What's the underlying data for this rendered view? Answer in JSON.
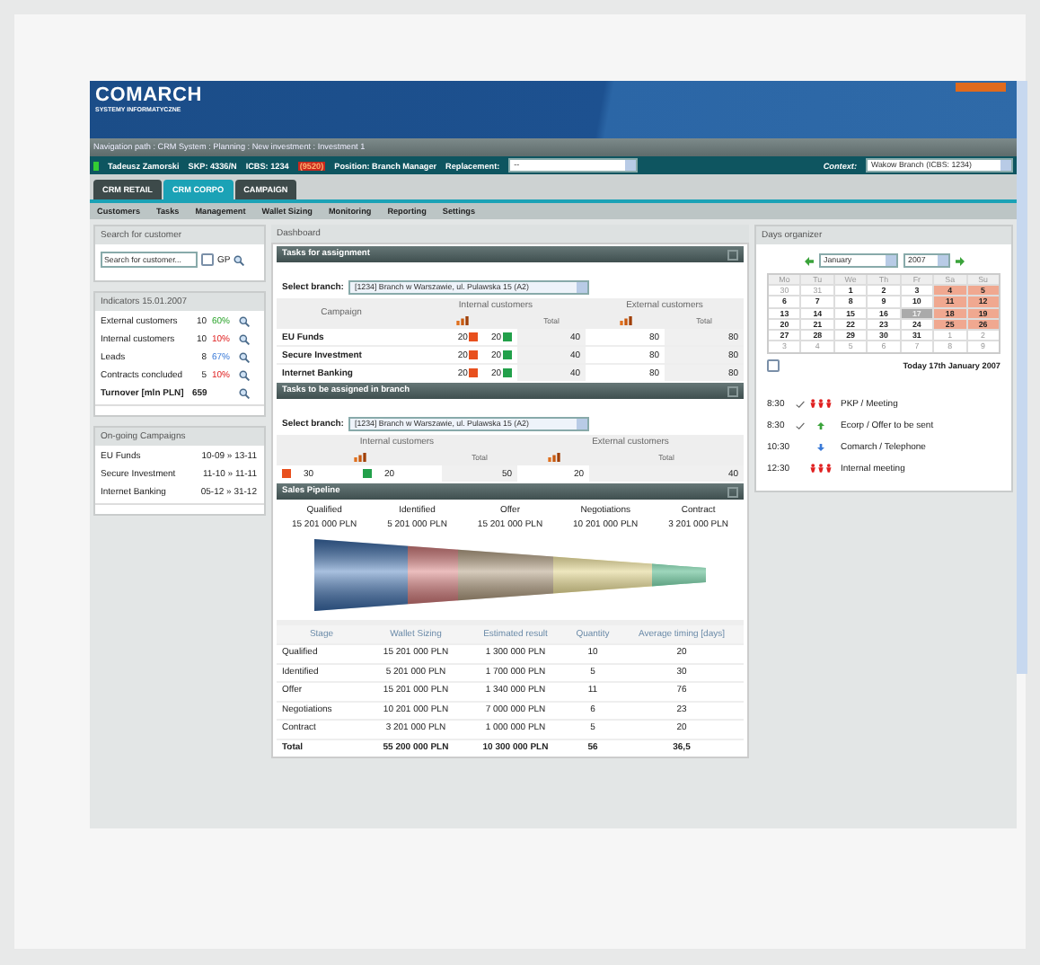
{
  "header": {
    "logo": "COMARCH",
    "tagline": "SYSTEMY INFORMATYCZNE"
  },
  "nav_path": "Navigation path : CRM System : Planning : New investment : Investment 1",
  "user_bar": {
    "user": "Tadeusz Zamorski",
    "skp": "SKP: 4336/N",
    "icbs": "ICBS: 1234",
    "icbs_code": "(9520)",
    "position": "Position: Branch Manager",
    "replacement_label": "Replacement:",
    "replacement_value": "--",
    "context_label": "Context:",
    "context_value": "Wakow Branch (ICBS: 1234)"
  },
  "tabs": [
    {
      "label": "CRM RETAIL",
      "selected": false
    },
    {
      "label": "CRM CORPO",
      "selected": true
    },
    {
      "label": "CAMPAIGN",
      "selected": false
    }
  ],
  "menu": [
    "Customers",
    "Tasks",
    "Management",
    "Wallet Sizing",
    "Monitoring",
    "Reporting",
    "Settings"
  ],
  "search": {
    "title": "Search for customer",
    "placeholder": "Search for customer...",
    "checkbox_label": "GP",
    "checked": false
  },
  "indicators": {
    "title": "Indicators 15.01.2007",
    "rows": [
      {
        "label": "External customers",
        "value": "10",
        "percent": "60%",
        "kind": "good",
        "bold": false
      },
      {
        "label": "Internal customers",
        "value": "10",
        "percent": "10%",
        "kind": "bad",
        "bold": false
      },
      {
        "label": "Leads",
        "value": "8",
        "percent": "67%",
        "kind": "info",
        "bold": false
      },
      {
        "label": "Contracts concluded",
        "value": "5",
        "percent": "10%",
        "kind": "bad",
        "bold": false
      },
      {
        "label": "Turnover [mln PLN]",
        "value": "659",
        "bold": true
      }
    ]
  },
  "campaigns": {
    "title": "On-going Campaigns",
    "rows": [
      {
        "name": "EU Funds",
        "dates": "10-09 » 13-11"
      },
      {
        "name": "Secure Investment",
        "dates": "11-10 » 11-11"
      },
      {
        "name": "Internet Banking",
        "dates": "05-12 » 31-12"
      }
    ]
  },
  "dashboard": {
    "title": "Dashboard",
    "tasks_for_assignment": {
      "title": "Tasks for assignment",
      "branch_label": "Select branch:",
      "branch_value": "[1234] Branch w Warszawie, ul. Pulawska 15 (A2)",
      "col_campaign": "Campaign",
      "col_internal": "Internal customers",
      "col_external": "External customers",
      "col_total_1": "Total",
      "col_total_2": "Total",
      "rows": [
        {
          "name": "EU Funds",
          "a": "20",
          "b": "20",
          "total": "40",
          "ext": "80",
          "ext_total": "80"
        },
        {
          "name": "Secure Investment",
          "a": "20",
          "b": "20",
          "total": "40",
          "ext": "80",
          "ext_total": "80"
        },
        {
          "name": "Internet Banking",
          "a": "20",
          "b": "20",
          "total": "40",
          "ext": "80",
          "ext_total": "80"
        }
      ]
    },
    "tasks_in_branch": {
      "title": "Tasks to be assigned in branch",
      "branch_label": "Select branch:",
      "branch_value": "[1234] Branch w Warszawie, ul. Pulawska 15 (A2)",
      "col_internal": "Internal customers",
      "col_external": "External customers",
      "col_total_1": "Total",
      "col_total_2": "Total",
      "a": "30",
      "b": "20",
      "total": "50",
      "ext": "20",
      "ext_total": "40"
    },
    "pipeline": {
      "title": "Sales Pipeline",
      "stages": [
        {
          "name": "Qualified",
          "value": "15 201 000 PLN"
        },
        {
          "name": "Identified",
          "value": "5 201 000 PLN"
        },
        {
          "name": "Offer",
          "value": "15 201 000 PLN"
        },
        {
          "name": "Negotiations",
          "value": "10 201 000 PLN"
        },
        {
          "name": "Contract",
          "value": "3 201 000 PLN"
        }
      ],
      "columns": [
        "Stage",
        "Wallet Sizing",
        "Estimated result",
        "Quantity",
        "Average timing [days]"
      ],
      "rows": [
        {
          "cells": [
            "Qualified",
            "15 201 000 PLN",
            "1 300 000 PLN",
            "10",
            "20"
          ],
          "bold": false
        },
        {
          "cells": [
            "Identified",
            "5 201 000 PLN",
            "1 700 000 PLN",
            "5",
            "30"
          ],
          "bold": false
        },
        {
          "cells": [
            "Offer",
            "15 201 000 PLN",
            "1 340 000 PLN",
            "11",
            "76"
          ],
          "bold": false
        },
        {
          "cells": [
            "Negotiations",
            "10 201 000 PLN",
            "7 000 000 PLN",
            "6",
            "23"
          ],
          "bold": false
        },
        {
          "cells": [
            "Contract",
            "3 201 000 PLN",
            "1 000 000 PLN",
            "5",
            "20"
          ],
          "bold": false
        },
        {
          "cells": [
            "Total",
            "55 200 000 PLN",
            "10 300 000 PLN",
            "56",
            "36,5"
          ],
          "bold": true
        }
      ]
    }
  },
  "organizer": {
    "title": "Days organizer",
    "month": "January",
    "year": "2007",
    "weekdays": [
      "Mo",
      "Tu",
      "We",
      "Th",
      "Fr",
      "Sa",
      "Su"
    ],
    "weeks": [
      [
        {
          "d": "30",
          "muted": true,
          "selected": false
        },
        {
          "d": "31",
          "muted": true,
          "selected": false
        },
        {
          "d": "1",
          "muted": false,
          "selected": false
        },
        {
          "d": "2",
          "muted": false,
          "selected": false
        },
        {
          "d": "3",
          "muted": false,
          "selected": false
        },
        {
          "d": "4",
          "muted": false,
          "selected": false
        },
        {
          "d": "5",
          "muted": false,
          "selected": false
        }
      ],
      [
        {
          "d": "6",
          "muted": false,
          "selected": false
        },
        {
          "d": "7",
          "muted": false,
          "selected": false
        },
        {
          "d": "8",
          "muted": false,
          "selected": false
        },
        {
          "d": "9",
          "muted": false,
          "selected": false
        },
        {
          "d": "10",
          "muted": false,
          "selected": false
        },
        {
          "d": "11",
          "muted": false,
          "selected": false
        },
        {
          "d": "12",
          "muted": false,
          "selected": false
        }
      ],
      [
        {
          "d": "13",
          "muted": false,
          "selected": false
        },
        {
          "d": "14",
          "muted": false,
          "selected": false
        },
        {
          "d": "15",
          "muted": false,
          "selected": false
        },
        {
          "d": "16",
          "muted": false,
          "selected": false
        },
        {
          "d": "17",
          "muted": false,
          "selected": true
        },
        {
          "d": "18",
          "muted": false,
          "selected": false
        },
        {
          "d": "19",
          "muted": false,
          "selected": false
        }
      ],
      [
        {
          "d": "20",
          "muted": false,
          "selected": false
        },
        {
          "d": "21",
          "muted": false,
          "selected": false
        },
        {
          "d": "22",
          "muted": false,
          "selected": false
        },
        {
          "d": "23",
          "muted": false,
          "selected": false
        },
        {
          "d": "24",
          "muted": false,
          "selected": false
        },
        {
          "d": "25",
          "muted": false,
          "selected": false
        },
        {
          "d": "26",
          "muted": false,
          "selected": false
        }
      ],
      [
        {
          "d": "27",
          "muted": false,
          "selected": false
        },
        {
          "d": "28",
          "muted": false,
          "selected": false
        },
        {
          "d": "29",
          "muted": false,
          "selected": false
        },
        {
          "d": "30",
          "muted": false,
          "selected": false
        },
        {
          "d": "31",
          "muted": false,
          "selected": false
        },
        {
          "d": "1",
          "muted": true,
          "selected": false
        },
        {
          "d": "2",
          "muted": true,
          "selected": false
        }
      ],
      [
        {
          "d": "3",
          "muted": true,
          "selected": false
        },
        {
          "d": "4",
          "muted": true,
          "selected": false
        },
        {
          "d": "5",
          "muted": true,
          "selected": false
        },
        {
          "d": "6",
          "muted": true,
          "selected": false
        },
        {
          "d": "7",
          "muted": true,
          "selected": false
        },
        {
          "d": "8",
          "muted": true,
          "selected": false
        },
        {
          "d": "9",
          "muted": true,
          "selected": false
        }
      ]
    ],
    "today_checked": false,
    "today": "Today 17th January 2007",
    "events": [
      {
        "time": "8:30",
        "done": true,
        "kind": "high",
        "text": "PKP / Meeting"
      },
      {
        "time": "8:30",
        "done": true,
        "kind": "normal",
        "text": "Ecorp / Offer to be sent"
      },
      {
        "time": "10:30",
        "done": false,
        "kind": "low",
        "text": "Comarch / Telephone"
      },
      {
        "time": "12:30",
        "done": false,
        "kind": "high",
        "text": "Internal meeting"
      }
    ]
  }
}
